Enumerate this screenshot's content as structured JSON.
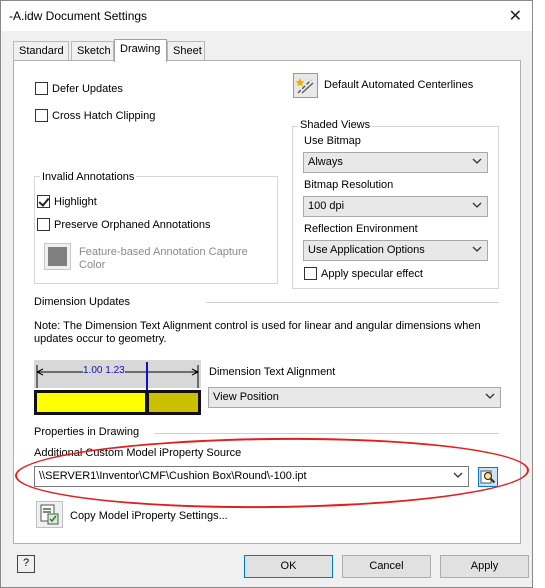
{
  "window": {
    "title": "-A.idw Document Settings",
    "close_glyph": "✕"
  },
  "tabs": [
    {
      "label": "Standard"
    },
    {
      "label": "Sketch"
    },
    {
      "label": "Drawing"
    },
    {
      "label": "Sheet"
    }
  ],
  "drawing": {
    "defer_updates": {
      "label": "Defer Updates",
      "checked": false
    },
    "cross_hatch_clipping": {
      "label": "Cross Hatch Clipping",
      "checked": false
    },
    "default_centerlines_label": "Default Automated Centerlines",
    "invalid_annotations": {
      "title": "Invalid Annotations",
      "highlight": {
        "label": "Highlight",
        "checked": true
      },
      "preserve_orphaned": {
        "label": "Preserve Orphaned Annotations",
        "checked": false
      },
      "capture_color_label_1": "Feature-based Annotation Capture",
      "capture_color_label_2": "Color",
      "capture_color_swatch": "#808080"
    },
    "shaded_views": {
      "title": "Shaded Views",
      "use_bitmap_label": "Use Bitmap",
      "use_bitmap_value": "Always",
      "bitmap_resolution_label": "Bitmap Resolution",
      "bitmap_resolution_value": "100 dpi",
      "reflection_label": "Reflection Environment",
      "reflection_value": "Use Application Options",
      "specular": {
        "label": "Apply specular effect",
        "checked": false
      }
    },
    "dimension_updates": {
      "title": "Dimension Updates",
      "note": "Note: The Dimension Text Alignment control is used for linear and angular dimensions when updates occur to geometry.",
      "preview_text": "1.00 1.23",
      "alignment_label": "Dimension Text Alignment",
      "alignment_value": "View Position"
    },
    "properties": {
      "title": "Properties in Drawing",
      "source_label": "Additional Custom Model iProperty Source",
      "source_value": "\\\\SERVER1\\Inventor\\CMF\\Cushion Box\\Round\\-100.ipt",
      "copy_label": "Copy Model iProperty Settings..."
    }
  },
  "buttons": {
    "help": "?",
    "ok": "OK",
    "cancel": "Cancel",
    "apply": "Apply"
  },
  "colors": {
    "annotation_ellipse": "#e02020",
    "preview_yellow": "#ffff00",
    "preview_olive": "#c8c000",
    "preview_blue": "#1010c0",
    "accent": "#0078d7"
  }
}
